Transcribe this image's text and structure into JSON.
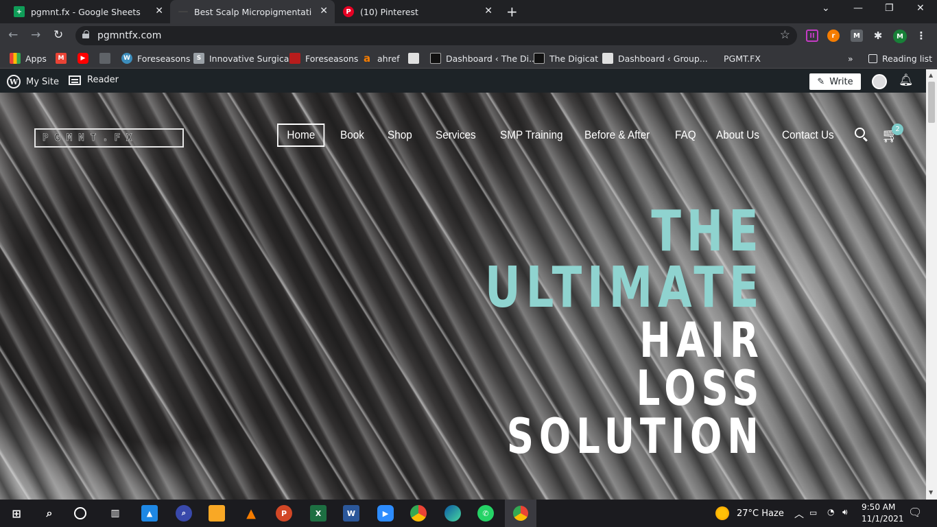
{
  "browser": {
    "tabs": [
      {
        "title": "pgmnt.fx - Google Sheets",
        "favicon": "sheets-icon",
        "color": "#0f9d58",
        "glyph": "+",
        "active": false
      },
      {
        "title": "Best Scalp Micropigmentation In",
        "favicon": "site-icon",
        "color": "#555555",
        "glyph": "",
        "active": true
      },
      {
        "title": "(10) Pinterest",
        "favicon": "pinterest-icon",
        "color": "#e60023",
        "glyph": "P",
        "active": false
      }
    ],
    "url": "pgmntfx.com",
    "bookmarks": [
      {
        "label": "Apps",
        "icon": "apps-icon",
        "color": "#ea4335"
      },
      {
        "label": "",
        "icon": "gmail-icon",
        "color": "#ea4335"
      },
      {
        "label": "",
        "icon": "youtube-icon",
        "color": "#ff0000"
      },
      {
        "label": "",
        "icon": "store-icon",
        "color": "#5f6368"
      },
      {
        "label": "Foreseasons",
        "icon": "wordpress-icon",
        "color": "#3c8dbc"
      },
      {
        "label": "Innovative Surgical",
        "icon": "surgical-icon",
        "color": "#9aa0a6"
      },
      {
        "label": "Foreseasons",
        "icon": "foreseasons-icon",
        "color": "#b71c1c"
      },
      {
        "label": "ahref",
        "icon": "ahrefs-icon",
        "color": "#f57c00"
      },
      {
        "label": "",
        "icon": "page-icon",
        "color": "#e0e0e0"
      },
      {
        "label": "Dashboard ‹ The Di...",
        "icon": "digicat-icon",
        "color": "#111111"
      },
      {
        "label": "The Digicat",
        "icon": "digicat-icon",
        "color": "#111111"
      },
      {
        "label": "Dashboard ‹ Group...",
        "icon": "page-icon",
        "color": "#e0e0e0"
      },
      {
        "label": "PGMT.FX",
        "icon": "pgmt-icon",
        "color": "#35363a"
      }
    ],
    "more": "»",
    "reading_list": "Reading list"
  },
  "wpbar": {
    "my_site": "My Site",
    "reader": "Reader",
    "write": "Write"
  },
  "site": {
    "logo": "PGMNT.FX",
    "nav": [
      "Home",
      "Book",
      "Shop",
      "Services",
      "SMP Training",
      "Before & After",
      "FAQ",
      "About Us",
      "Contact Us"
    ],
    "active_nav": "Home",
    "cart_count": "2",
    "hero": {
      "line1": "THE",
      "line2": "ULTIMATE",
      "line3": "HAIR",
      "line4": "LOSS",
      "line5": "SOLUTION"
    },
    "accent_color": "#8fd3cf"
  },
  "taskbar": {
    "weather": "27°C  Haze",
    "time": "9:50 AM",
    "date": "11/1/2021"
  }
}
